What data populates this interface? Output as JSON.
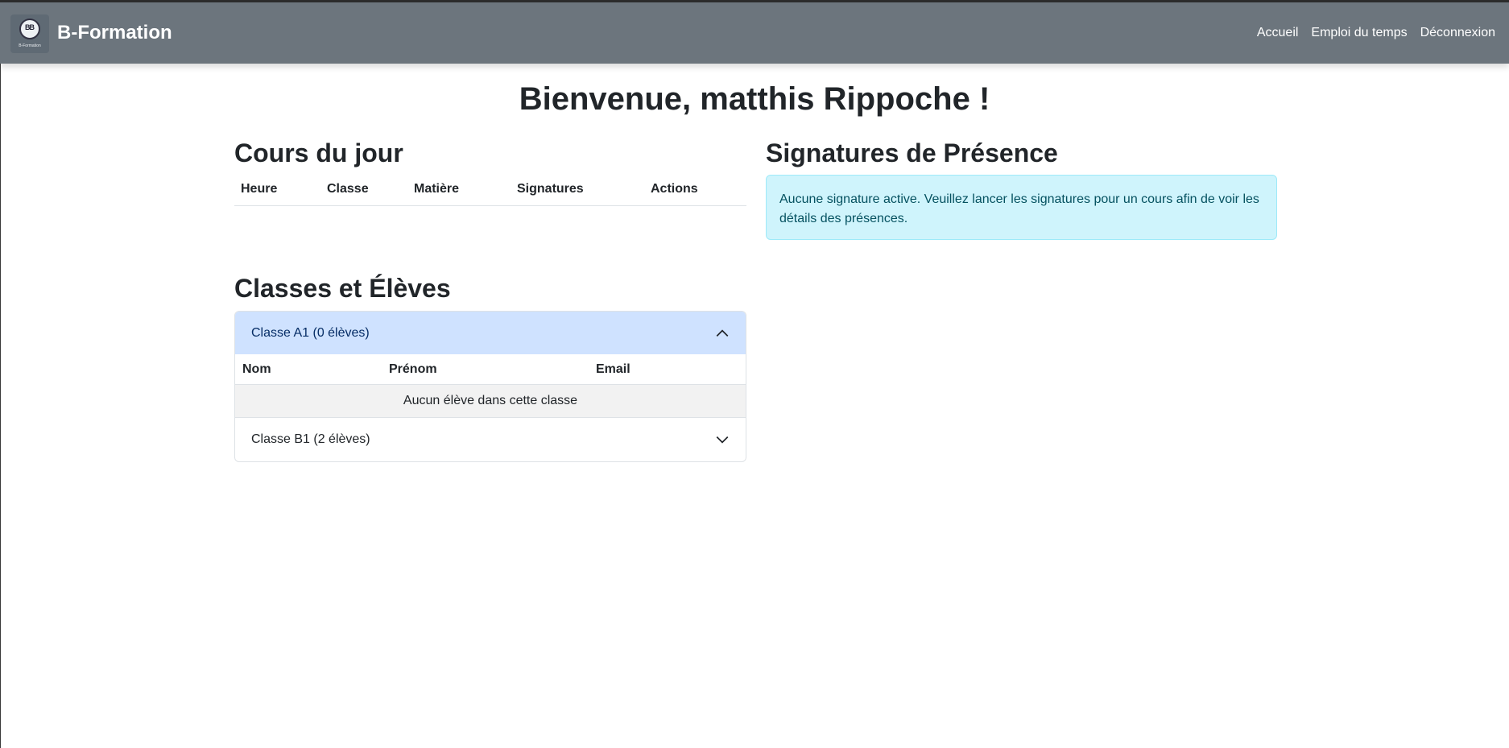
{
  "navbar": {
    "brand": "B-Formation",
    "logo_caption": "B-Formation",
    "links": [
      "Accueil",
      "Emploi du temps",
      "Déconnexion"
    ]
  },
  "welcome_title": "Bienvenue, matthis Rippoche !",
  "courses": {
    "title": "Cours du jour",
    "columns": [
      "Heure",
      "Classe",
      "Matière",
      "Signatures",
      "Actions"
    ]
  },
  "signatures": {
    "title": "Signatures de Présence",
    "info_message": "Aucune signature active. Veuillez lancer les signatures pour un cours afin de voir les détails des présences."
  },
  "classes": {
    "title": "Classes et Élèves",
    "items": [
      {
        "label": "Classe A1 (0 élèves)",
        "expanded": true,
        "columns": [
          "Nom",
          "Prénom",
          "Email"
        ],
        "empty_message": "Aucun élève dans cette classe"
      },
      {
        "label": "Classe B1 (2 élèves)",
        "expanded": false
      }
    ]
  },
  "colors": {
    "navbar": "#6c757d",
    "info_bg": "#cff4fc",
    "accordion_active": "#cfe2ff"
  },
  "icons": {
    "logo": "b-formation-logo",
    "expanded": "chevron-up-icon",
    "collapsed": "chevron-down-icon"
  }
}
